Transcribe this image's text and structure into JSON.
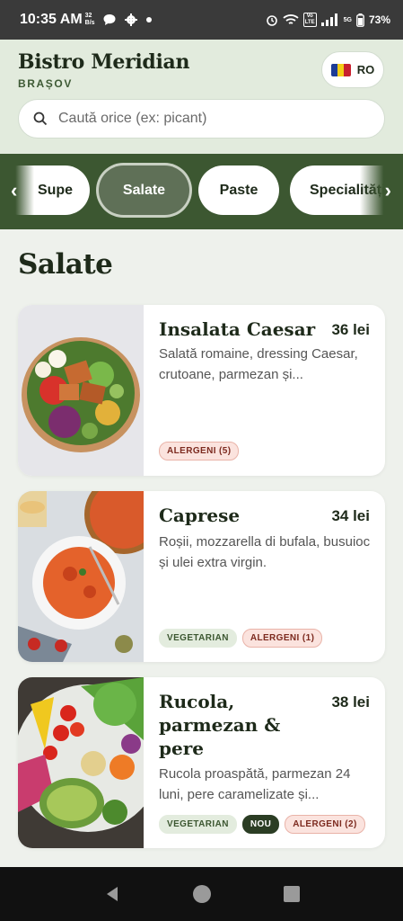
{
  "status_bar": {
    "time": "10:35 AM",
    "net_speed": "32",
    "net_unit": "B/s",
    "network": "5G",
    "battery": "73%"
  },
  "header": {
    "restaurant_name": "Bistro Meridian",
    "city": "BRAȘOV",
    "language": "RO",
    "search_placeholder": "Caută orice (ex: picant)"
  },
  "categories": [
    {
      "label": "Supe",
      "active": false
    },
    {
      "label": "Salate",
      "active": true
    },
    {
      "label": "Paste",
      "active": false
    },
    {
      "label": "Specialități",
      "active": false
    }
  ],
  "section_title": "Salate",
  "dishes": [
    {
      "name": "Insalata Caesar",
      "price": "36 lei",
      "description": "Salată romaine, dressing Caesar, crutoane, parmezan și...",
      "tags": {
        "allergens": "ALERGENI (5)"
      }
    },
    {
      "name": "Caprese",
      "price": "34 lei",
      "description": "Roșii, mozzarella di bufala, busuioc și ulei extra virgin.",
      "tags": {
        "vegetarian": "VEGETARIAN",
        "allergens": "ALERGENI (1)"
      }
    },
    {
      "name": "Rucola, parmezan & pere",
      "price": "38 lei",
      "description": "Rucola proaspătă, parmezan 24 luni, pere caramelizate și...",
      "tags": {
        "vegetarian": "VEGETARIAN",
        "new": "NOU",
        "allergens": "ALERGENI (2)"
      }
    }
  ],
  "colors": {
    "brand_green": "#3c5731",
    "active_pill": "#5f7057",
    "header_bg": "#e2ebdd",
    "allergen_bg": "#fbe3de"
  }
}
